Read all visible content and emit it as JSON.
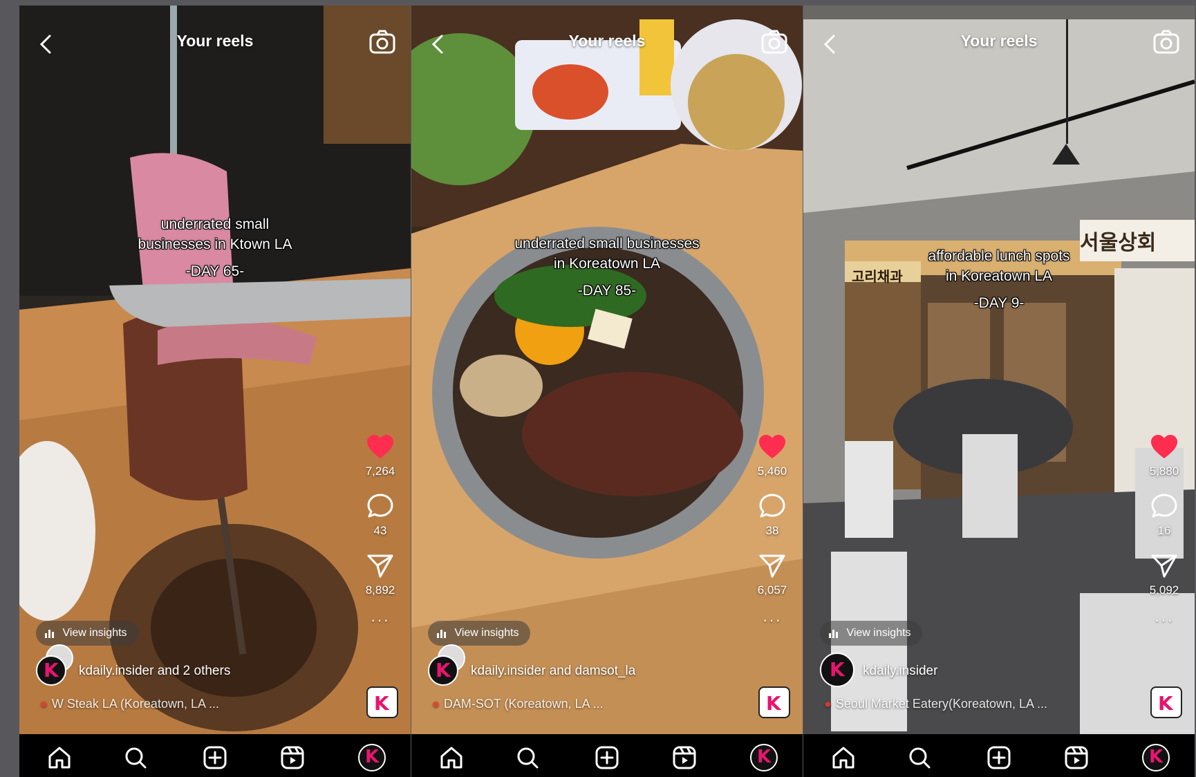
{
  "reels": [
    {
      "title": "Your reels",
      "caption_line1": "underrated small",
      "caption_line2": "businesses in Ktown LA",
      "caption_day": "-DAY 65-",
      "likes": "7,264",
      "comments": "43",
      "shares": "8,892",
      "insights_label": "View insights",
      "username": "kdaily.insider and 2 others",
      "location": "W Steak LA (Koreatown, LA ..."
    },
    {
      "title": "Your reels",
      "caption_line1": "underrated small businesses",
      "caption_line2": "in Koreatown LA",
      "caption_day": "-DAY 85-",
      "likes": "5,460",
      "comments": "38",
      "shares": "6,057",
      "insights_label": "View insights",
      "username": "kdaily.insider and damsot_la",
      "location": "DAM-SOT (Koreatown, LA ..."
    },
    {
      "title": "Your reels",
      "caption_line1": "affordable lunch spots",
      "caption_line2": "in Koreatown LA",
      "caption_day": "-DAY 9-",
      "likes": "5,880",
      "comments": "16",
      "shares": "5,092",
      "insights_label": "View insights",
      "username": "kdaily.insider",
      "location": "Seoul Market Eatery(Koreatown, LA ...",
      "sign_korean_left": "고리채과",
      "sign_korean_right": "서울상회"
    }
  ],
  "icons": {
    "back": "chevron-left-icon",
    "camera": "camera-icon",
    "like": "heart-icon",
    "comment": "comment-icon",
    "share": "send-icon",
    "more": "more-icon",
    "nav": [
      "home-icon",
      "search-icon",
      "create-icon",
      "reels-icon",
      "profile-icon"
    ]
  },
  "colors": {
    "heart": "#ff2d4f",
    "brand_k": "#e8156e",
    "nav_bg": "#000000",
    "frame_bg": "#58585c"
  }
}
